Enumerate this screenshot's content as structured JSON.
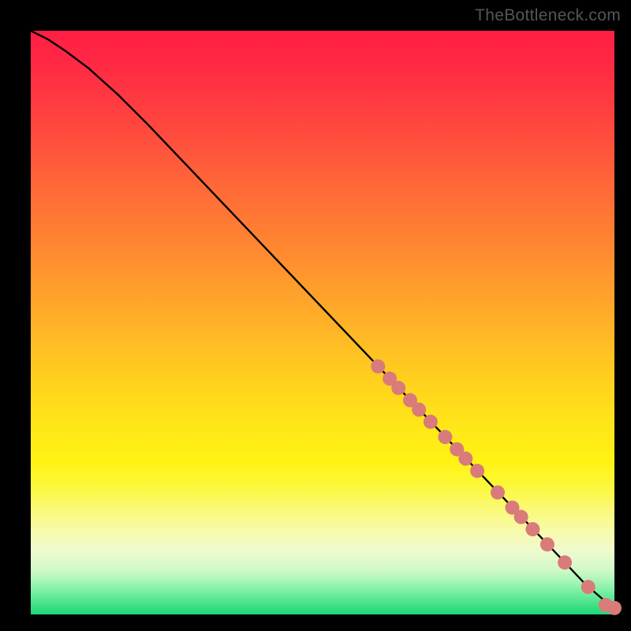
{
  "attribution": "TheBottleneck.com",
  "chart_data": {
    "type": "line",
    "title": "",
    "xlabel": "",
    "ylabel": "",
    "xlim": [
      0,
      100
    ],
    "ylim": [
      0,
      100
    ],
    "series": [
      {
        "name": "curve",
        "x": [
          0,
          3,
          6,
          10,
          15,
          20,
          30,
          40,
          50,
          60,
          70,
          80,
          90,
          95,
          98,
          100
        ],
        "y": [
          100,
          98.5,
          96.5,
          93.5,
          89,
          84,
          73.5,
          63,
          52.5,
          42,
          31.5,
          21,
          10.5,
          5.2,
          2.6,
          1.2
        ]
      }
    ],
    "markers": {
      "name": "highlighted-points",
      "color": "#d97b7a",
      "radius": 9,
      "points": [
        {
          "x": 59.5,
          "y": 42.5
        },
        {
          "x": 61.5,
          "y": 40.4
        },
        {
          "x": 63.0,
          "y": 38.8
        },
        {
          "x": 65.0,
          "y": 36.7
        },
        {
          "x": 66.5,
          "y": 35.1
        },
        {
          "x": 68.5,
          "y": 33.0
        },
        {
          "x": 71.0,
          "y": 30.4
        },
        {
          "x": 73.0,
          "y": 28.3
        },
        {
          "x": 74.5,
          "y": 26.7
        },
        {
          "x": 76.5,
          "y": 24.6
        },
        {
          "x": 80.0,
          "y": 20.9
        },
        {
          "x": 82.5,
          "y": 18.3
        },
        {
          "x": 84.0,
          "y": 16.7
        },
        {
          "x": 86.0,
          "y": 14.6
        },
        {
          "x": 88.5,
          "y": 12.0
        },
        {
          "x": 91.5,
          "y": 8.9
        },
        {
          "x": 95.5,
          "y": 4.7
        },
        {
          "x": 98.5,
          "y": 1.6
        },
        {
          "x": 100.0,
          "y": 1.1
        }
      ]
    },
    "background": {
      "type": "vertical-gradient",
      "stops": [
        {
          "pos": 0,
          "color": "#ff1e44"
        },
        {
          "pos": 50,
          "color": "#ffb128"
        },
        {
          "pos": 78,
          "color": "#fcf83a"
        },
        {
          "pos": 100,
          "color": "#1ad874"
        }
      ]
    }
  }
}
